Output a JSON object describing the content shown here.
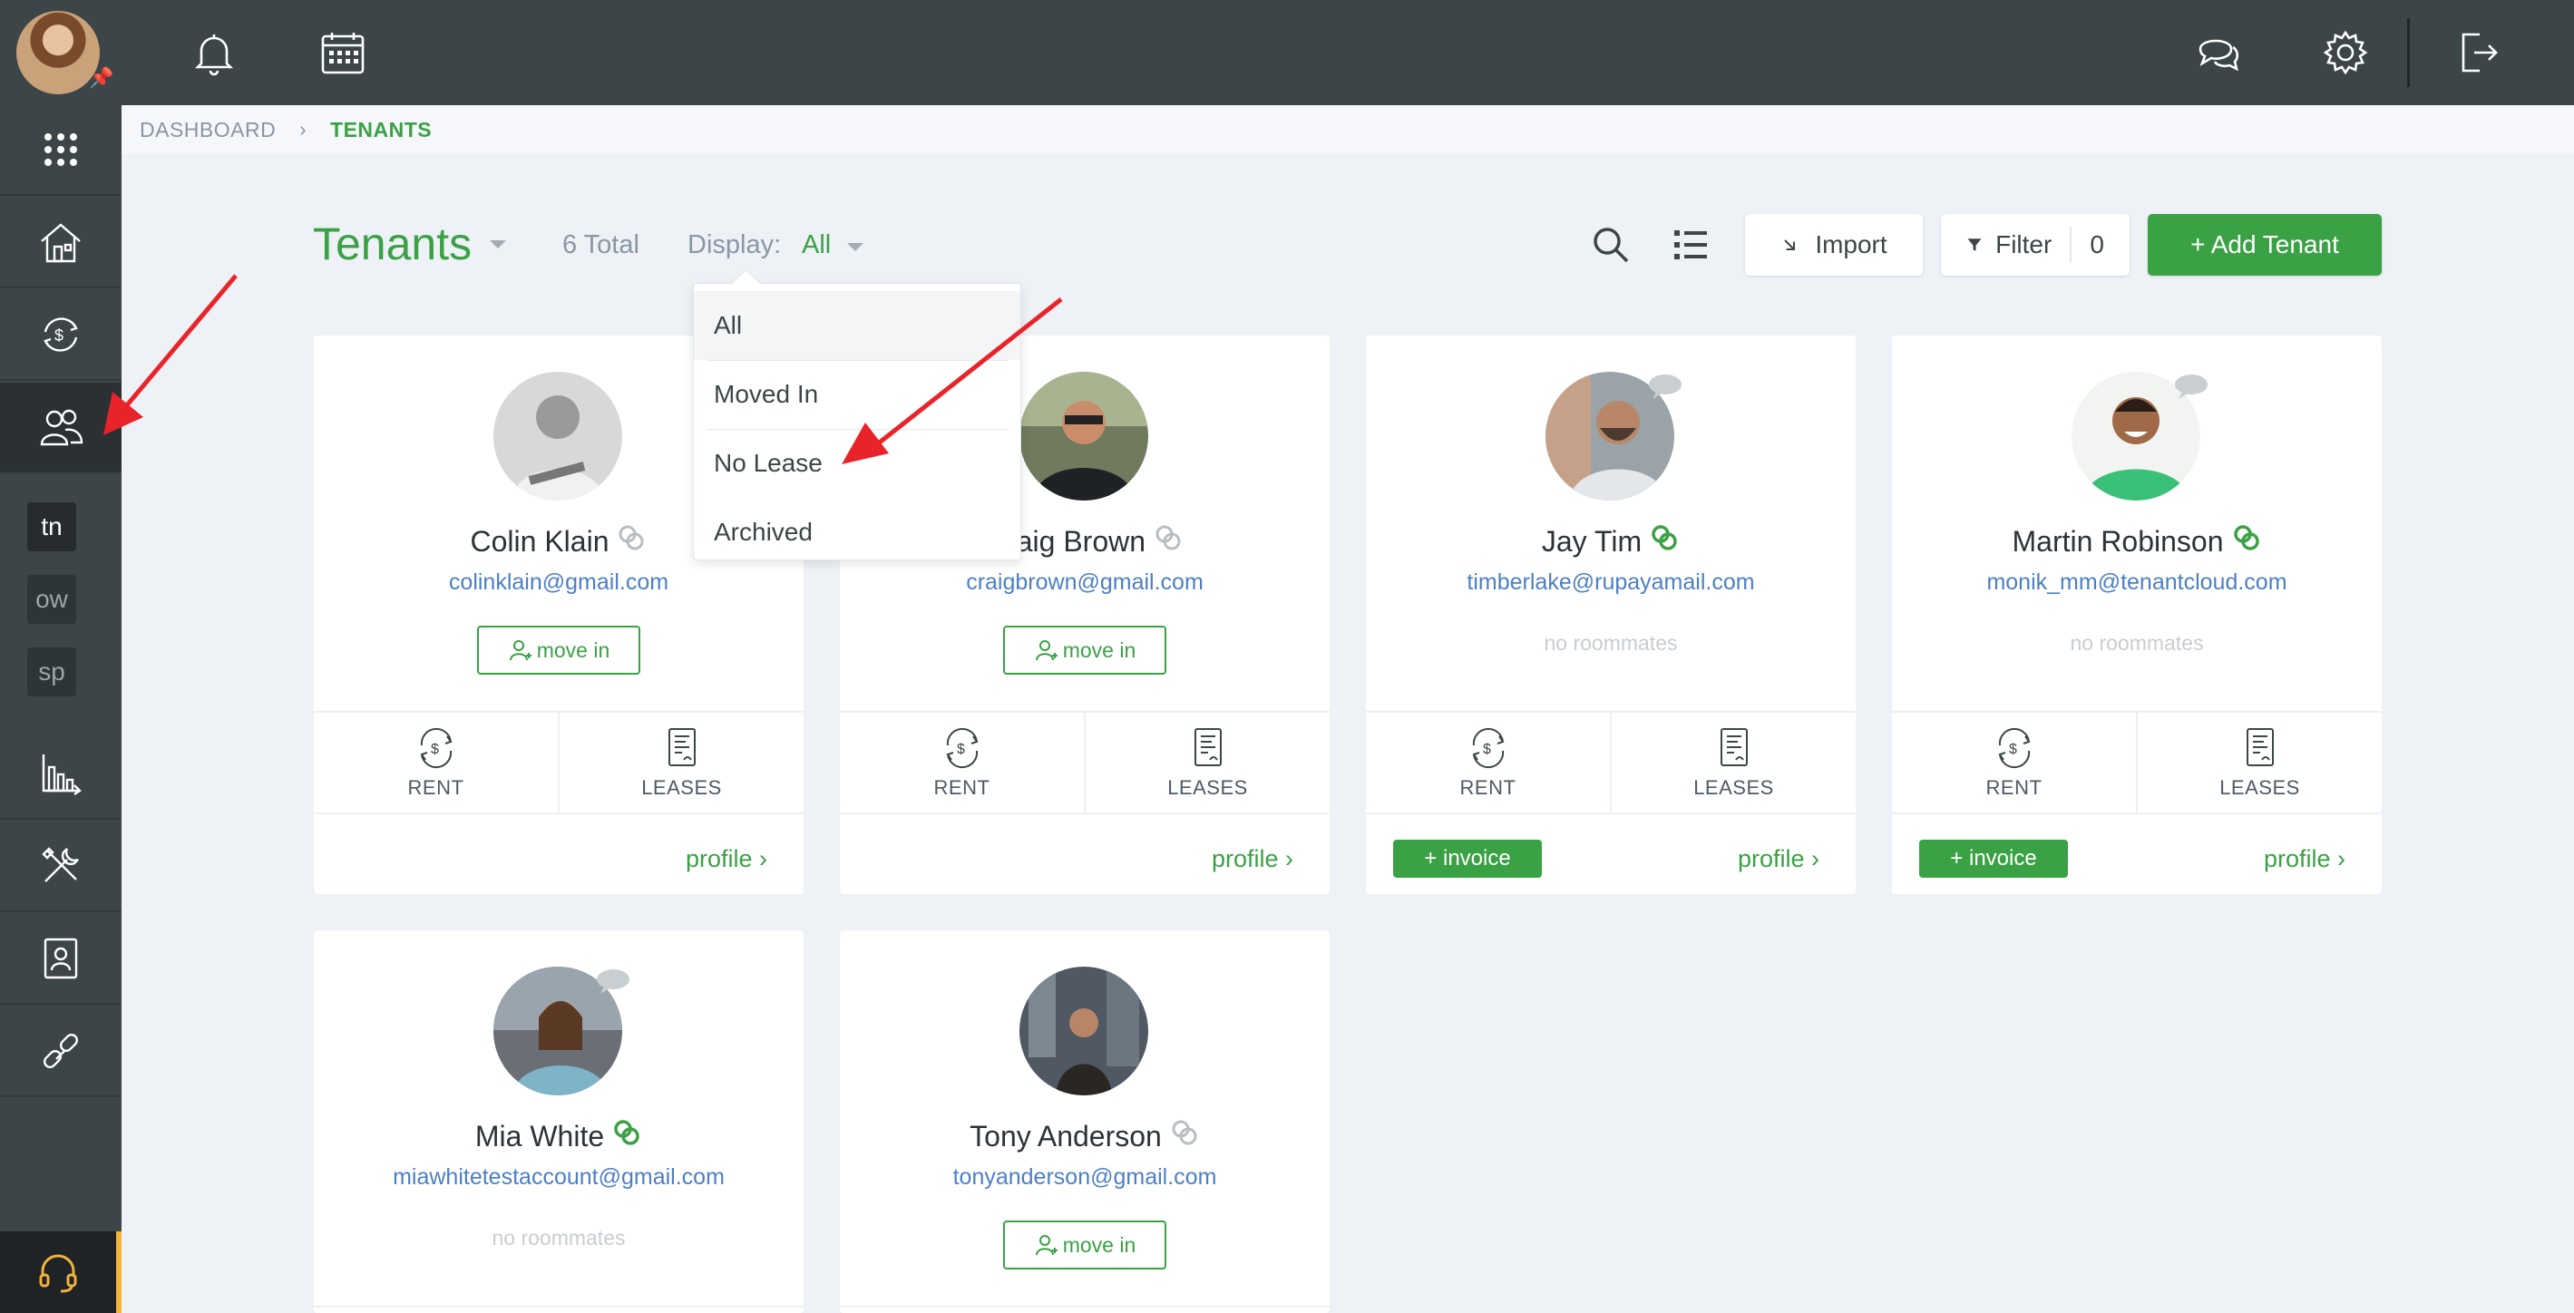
{
  "breadcrumb": {
    "home": "DASHBOARD",
    "current": "TENANTS"
  },
  "header": {
    "title": "Tenants",
    "total": "6 Total",
    "display_label": "Display:",
    "display_value": "All",
    "import_label": "Import",
    "filter_label": "Filter",
    "filter_count": "0",
    "add_label": "+ Add Tenant"
  },
  "display_dropdown": {
    "options": [
      "All",
      "Moved In",
      "No Lease",
      "Archived"
    ],
    "selected": "All"
  },
  "sidebar": {
    "mini_items": [
      "tn",
      "ow",
      "sp"
    ]
  },
  "tenants": [
    {
      "name": "Colin Klain",
      "email": "colinklain@gmail.com",
      "action": "move in",
      "linked": false,
      "rent": "RENT",
      "leases": "LEASES",
      "profile": "profile ›"
    },
    {
      "name": "Craig Brown",
      "email": "craigbrown@gmail.com",
      "action": "move in",
      "linked": false,
      "rent": "RENT",
      "leases": "LEASES",
      "profile": "profile ›"
    },
    {
      "name": "Jay Tim",
      "email": "timberlake@rupayamail.com",
      "roommates": "no roommates",
      "linked": true,
      "rent": "RENT",
      "leases": "LEASES",
      "invoice": "+ invoice",
      "profile": "profile ›"
    },
    {
      "name": "Martin Robinson",
      "email": "monik_mm@tenantcloud.com",
      "roommates": "no roommates",
      "linked": true,
      "rent": "RENT",
      "leases": "LEASES",
      "invoice": "+ invoice",
      "profile": "profile ›"
    },
    {
      "name": "Mia White",
      "email": "miawhitetestaccount@gmail.com",
      "roommates": "no roommates",
      "linked": true
    },
    {
      "name": "Tony Anderson",
      "email": "tonyanderson@gmail.com",
      "action": "move in",
      "linked": false
    }
  ],
  "colors": {
    "accent": "#3aa145",
    "sidebar": "#3c4547",
    "link": "#4d7fc5",
    "annotation_arrow": "#e8242a"
  }
}
